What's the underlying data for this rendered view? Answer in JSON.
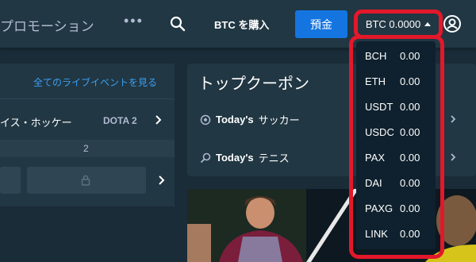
{
  "nav": {
    "promotions_label": "プロモーション",
    "more_label": "•••",
    "buy_btc_label": "BTC を購入",
    "deposit_label": "預金",
    "wallet_balance": "BTC 0.0000"
  },
  "left": {
    "live_link": "全てのライブイベントを見る",
    "sport_tab": "イス・ホッケー",
    "dota_tab": "DOTA 2",
    "score": "2"
  },
  "coupons": {
    "title": "トップクーポン",
    "items": [
      {
        "prefix": "Today's",
        "sport": "サッカー"
      },
      {
        "prefix": "Today's",
        "sport": "テニス"
      }
    ]
  },
  "wallet_dropdown": {
    "currencies": [
      {
        "code": "BCH",
        "amount": "0.00"
      },
      {
        "code": "ETH",
        "amount": "0.00"
      },
      {
        "code": "USDT",
        "amount": "0.00"
      },
      {
        "code": "USDC",
        "amount": "0.00"
      },
      {
        "code": "PAX",
        "amount": "0.00"
      },
      {
        "code": "DAI",
        "amount": "0.00"
      },
      {
        "code": "PAXG",
        "amount": "0.00"
      },
      {
        "code": "LINK",
        "amount": "0.00"
      }
    ]
  },
  "colors": {
    "accent": "#1475e1",
    "highlight": "#e3182a",
    "background": "#1a2c38",
    "panel": "#213743"
  }
}
